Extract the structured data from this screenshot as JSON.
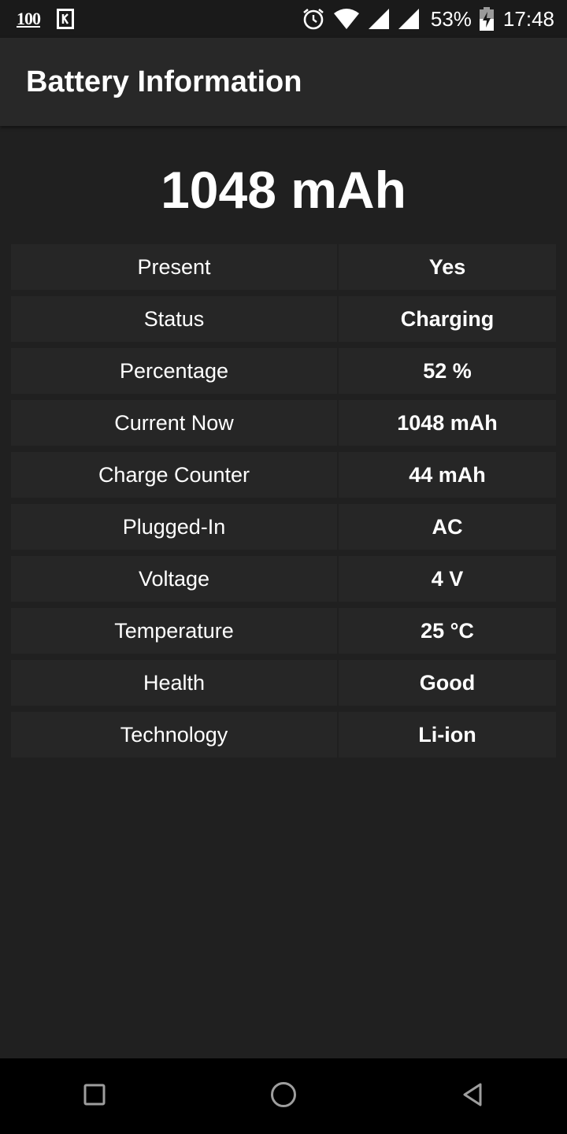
{
  "status_bar": {
    "notification_text": "100",
    "battery_percent": "53%",
    "time": "17:48",
    "icons": [
      "notification-100-icon",
      "k-app-icon",
      "alarm-icon",
      "wifi-icon",
      "signal-icon",
      "signal-icon",
      "battery-charging-icon"
    ]
  },
  "app_bar": {
    "title": "Battery Information"
  },
  "headline": {
    "value": "1048 mAh"
  },
  "rows": [
    {
      "label": "Present",
      "value": "Yes"
    },
    {
      "label": "Status",
      "value": "Charging"
    },
    {
      "label": "Percentage",
      "value": "52 %"
    },
    {
      "label": "Current Now",
      "value": "1048 mAh"
    },
    {
      "label": "Charge Counter",
      "value": "44 mAh"
    },
    {
      "label": "Plugged-In",
      "value": "AC"
    },
    {
      "label": "Voltage",
      "value": "4 V"
    },
    {
      "label": "Temperature",
      "value": "25 °C"
    },
    {
      "label": "Health",
      "value": "Good"
    },
    {
      "label": "Technology",
      "value": "Li-ion"
    }
  ],
  "nav_bar": {
    "icons": [
      "recents-square-icon",
      "home-circle-icon",
      "back-triangle-icon"
    ]
  },
  "colors": {
    "background": "#202020",
    "app_bar": "#282828",
    "row_cell": "#262626",
    "status_bar": "#1a1a1a",
    "nav_bar": "#000000",
    "text": "#ffffff"
  }
}
